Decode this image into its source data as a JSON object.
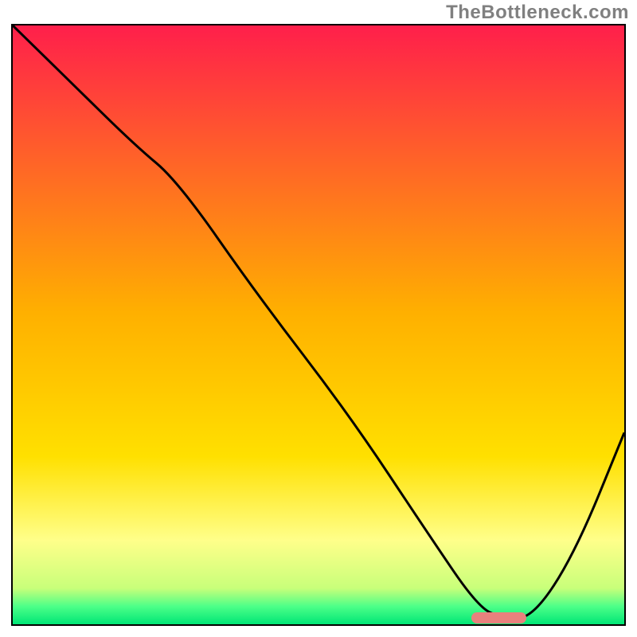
{
  "watermark": "TheBottleneck.com",
  "colors": {
    "gradient_top": "#ff1f4b",
    "gradient_mid": "#ffd400",
    "gradient_low_yellow": "#ffff7a",
    "gradient_green_edge": "#00e676",
    "curve": "#000000",
    "marker": "#e8817d",
    "border": "#000000",
    "watermark": "#808080"
  },
  "chart_data": {
    "type": "line",
    "title": "",
    "xlabel": "",
    "ylabel": "",
    "xlim": [
      0,
      100
    ],
    "ylim": [
      0,
      100
    ],
    "note": "Chart has no visible axis ticks, tick labels, or legend. Values are visual estimates of the single plotted curve (percentage-of-width vs percentage-of-height). The curve starts near the top-left, descends steeply, reaches ~0 around x≈78–85, then rises toward the right edge.",
    "series": [
      {
        "name": "curve",
        "x": [
          0,
          10,
          20,
          27,
          40,
          55,
          68,
          76,
          80,
          85,
          92,
          100
        ],
        "y": [
          100,
          90,
          80,
          74,
          55,
          35,
          15,
          3,
          1,
          1,
          12,
          32
        ]
      }
    ],
    "marker": {
      "comment": "Short horizontal pink segment near curve minimum",
      "x_start": 75,
      "x_end": 84,
      "y": 1
    },
    "background_gradient_stops": [
      {
        "pct": 0,
        "color": "#ff1f4b"
      },
      {
        "pct": 48,
        "color": "#ffb000"
      },
      {
        "pct": 72,
        "color": "#ffe000"
      },
      {
        "pct": 86,
        "color": "#ffff8a"
      },
      {
        "pct": 94,
        "color": "#c8ff7a"
      },
      {
        "pct": 97,
        "color": "#4dff88"
      },
      {
        "pct": 100,
        "color": "#00e676"
      }
    ]
  }
}
